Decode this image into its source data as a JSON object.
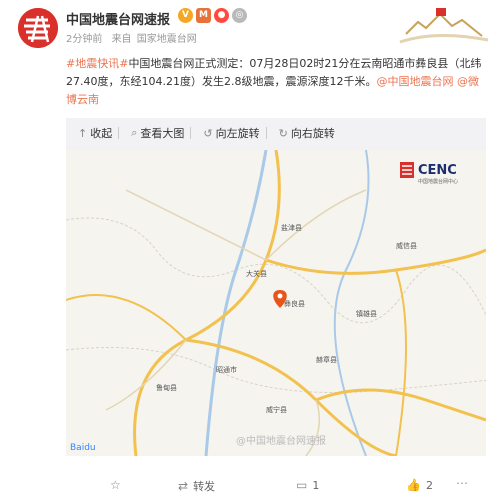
{
  "header": {
    "account_name": "中国地震台网速报",
    "badges": [
      "V",
      "M",
      "●",
      "◎"
    ],
    "time": "2分钟前",
    "source_prefix": "来自",
    "source": "国家地震台网"
  },
  "post": {
    "hashtag1": "#地震快讯#",
    "body": "中国地震台网正式测定：07月28日02时21分在云南昭通市彝良县（北纬27.40度，东经104.21度）发生2.8级地震，震源深度12千米。",
    "mention1": "@中国地震台网",
    "mention2": "@微博云南"
  },
  "toolbar": {
    "collapse": "收起",
    "view_original": "查看大图",
    "rotate_left": "向左旋转",
    "rotate_right": "向右旋转"
  },
  "map": {
    "logo_text": "CENC",
    "logo_subtitle": "中国地震台网中心",
    "watermark": "@中国地震台网速报",
    "baidu_label": "Baidu",
    "colors": {
      "road": "#f2c14e",
      "water": "#a9c9e8",
      "land": "#f6f4ef",
      "epicenter": "#e8551b"
    },
    "place_labels": [
      "盐津县",
      "大关县",
      "彝良县",
      "威信县",
      "赫章县",
      "镇雄县",
      "昭通市",
      "鲁甸县",
      "威宁县"
    ]
  },
  "actions": {
    "repost": "转发",
    "comment_count": "1",
    "like_count": "2"
  }
}
